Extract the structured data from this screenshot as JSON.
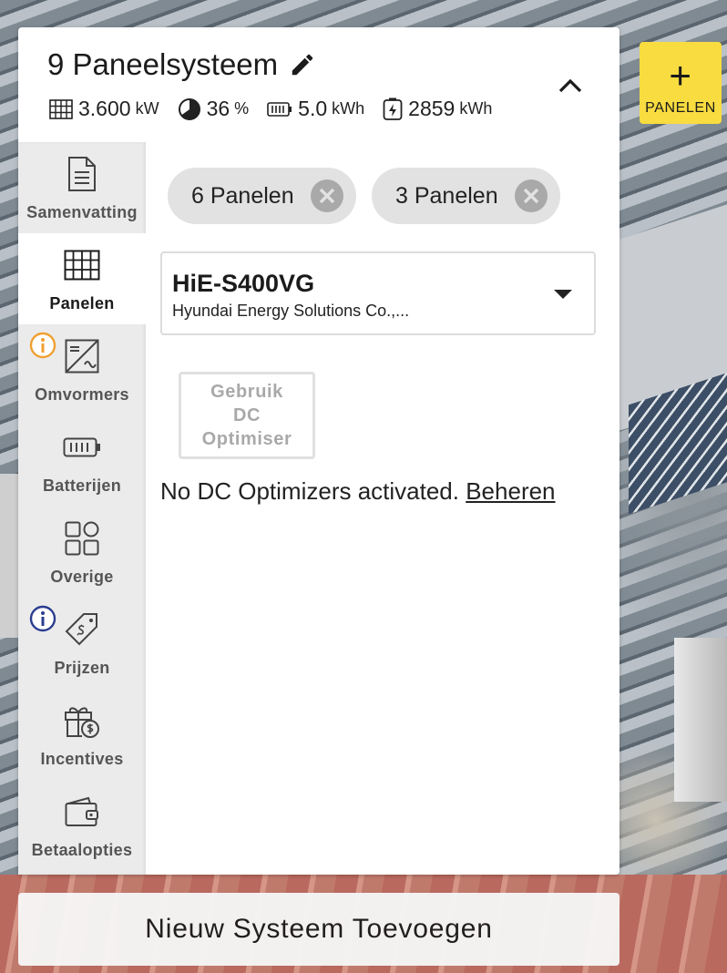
{
  "system": {
    "title": "9 Paneelsysteem",
    "stats": {
      "power_value": "3.600",
      "power_unit": "kW",
      "coverage_value": "36",
      "coverage_unit": "%",
      "battery_value": "5.0",
      "battery_unit": "kWh",
      "production_value": "2859",
      "production_unit": "kWh"
    }
  },
  "add_panels_button": {
    "label": "PANELEN"
  },
  "sidebar": {
    "items": [
      {
        "label": "Samenvatting",
        "icon": "document-icon",
        "active": false
      },
      {
        "label": "Panelen",
        "icon": "solar-panel-icon",
        "active": true
      },
      {
        "label": "Omvormers",
        "icon": "inverter-icon",
        "active": false,
        "badge": "orange-info"
      },
      {
        "label": "Batterijen",
        "icon": "battery-icon",
        "active": false
      },
      {
        "label": "Overige",
        "icon": "grid-shapes-icon",
        "active": false
      },
      {
        "label": "Prijzen",
        "icon": "price-tag-icon",
        "active": false,
        "badge": "blue-info"
      },
      {
        "label": "Incentives",
        "icon": "gift-icon",
        "active": false
      },
      {
        "label": "Betaalopties",
        "icon": "wallet-icon",
        "active": false
      }
    ]
  },
  "content": {
    "chips": [
      {
        "label": "6 Panelen"
      },
      {
        "label": "3 Panelen"
      }
    ],
    "panel_select": {
      "model": "HiE-S400VG",
      "manufacturer": "Hyundai Energy Solutions Co.,..."
    },
    "optimiser_button": {
      "line1": "Gebruik",
      "line2": "DC",
      "line3": "Optimiser"
    },
    "note": {
      "text": "No DC Optimizers activated.",
      "link": "Beheren"
    }
  },
  "new_system_button": {
    "label": "Nieuw Systeem Toevoegen"
  },
  "colors": {
    "accent_yellow": "#f8dc40",
    "info_orange": "#f0a030",
    "info_blue": "#2a3d8f"
  }
}
